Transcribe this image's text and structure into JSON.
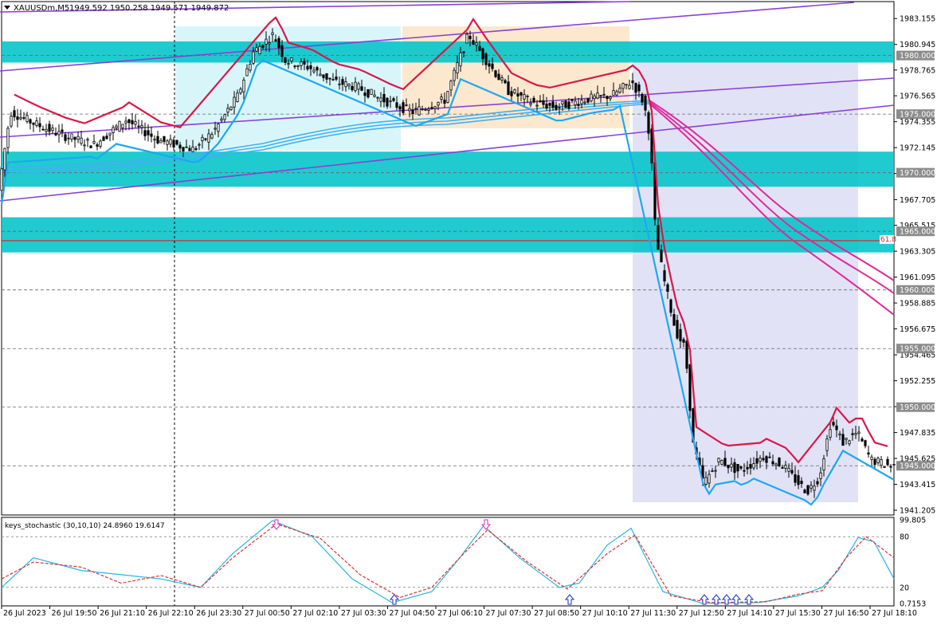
{
  "header": {
    "symbol": "XAUUSDm,M5",
    "ohlc": "1949.592 1950.258 1949.571 1949.872",
    "menu_icon": "triangle-down-icon"
  },
  "chart_data": [
    {
      "type": "candlestick",
      "symbol": "XAUUSDm",
      "timeframe": "M5",
      "ylim": [
        1940.8,
        1984.6
      ],
      "price_ticks": [
        "1983.155",
        "1980.945",
        "1978.765",
        "1976.565",
        "1974.355",
        "1972.145",
        "1969.935",
        "1967.705",
        "1965.515",
        "1963.305",
        "1961.095",
        "1958.885",
        "1956.675",
        "1954.465",
        "1952.255",
        "1950.045",
        "1947.835",
        "1945.625",
        "1943.415",
        "1941.205"
      ],
      "time_ticks": [
        "26 Jul 2023",
        "26 Jul 19:50",
        "26 Jul 21:10",
        "26 Jul 22:10",
        "26 Jul 23:30",
        "27 Jul 00:50",
        "27 Jul 02:10",
        "27 Jul 03:30",
        "27 Jul 04:50",
        "27 Jul 06:10",
        "27 Jul 07:30",
        "27 Jul 08:50",
        "27 Jul 10:10",
        "27 Jul 11:30",
        "27 Jul 12:50",
        "27 Jul 14:10",
        "27 Jul 15:30",
        "27 Jul 16:50",
        "27 Jul 18:10"
      ],
      "key_levels": [
        {
          "label": "1980.000",
          "value": 1980.0
        },
        {
          "label": "1975.000",
          "value": 1975.0
        },
        {
          "label": "1970.000",
          "value": 1970.0
        },
        {
          "label": "1965.000",
          "value": 1965.0
        },
        {
          "label": "1960.000",
          "value": 1960.0
        },
        {
          "label": "1955.000",
          "value": 1955.0
        },
        {
          "label": "1950.000",
          "value": 1950.0
        },
        {
          "label": "1945.000",
          "value": 1945.0
        }
      ],
      "fib_level": {
        "label": "61.8",
        "value": 1964.2
      },
      "zones": [
        {
          "low": 1979.4,
          "high": 1981.2,
          "color": "#00c4c8"
        },
        {
          "low": 1968.8,
          "high": 1971.8,
          "color": "#00c4c8"
        },
        {
          "low": 1963.2,
          "high": 1966.2,
          "color": "#00c4c8"
        }
      ],
      "series_points": [
        {
          "t": 0,
          "price": 1968.5
        },
        {
          "t": 15,
          "price": 1975.2
        },
        {
          "t": 45,
          "price": 1974.2
        },
        {
          "t": 80,
          "price": 1973.2
        },
        {
          "t": 120,
          "price": 1972.4
        },
        {
          "t": 160,
          "price": 1974.5
        },
        {
          "t": 200,
          "price": 1972.8
        },
        {
          "t": 245,
          "price": 1972.0
        },
        {
          "t": 270,
          "price": 1973.5
        },
        {
          "t": 300,
          "price": 1976.5
        },
        {
          "t": 320,
          "price": 1980.3
        },
        {
          "t": 345,
          "price": 1981.8
        },
        {
          "t": 360,
          "price": 1979.6
        },
        {
          "t": 390,
          "price": 1979.0
        },
        {
          "t": 420,
          "price": 1977.8
        },
        {
          "t": 450,
          "price": 1977.3
        },
        {
          "t": 490,
          "price": 1976.0
        },
        {
          "t": 520,
          "price": 1975.2
        },
        {
          "t": 560,
          "price": 1976.2
        },
        {
          "t": 590,
          "price": 1981.8
        },
        {
          "t": 610,
          "price": 1979.8
        },
        {
          "t": 640,
          "price": 1977.0
        },
        {
          "t": 670,
          "price": 1976.0
        },
        {
          "t": 700,
          "price": 1975.6
        },
        {
          "t": 740,
          "price": 1976.3
        },
        {
          "t": 770,
          "price": 1976.6
        },
        {
          "t": 795,
          "price": 1977.8
        },
        {
          "t": 810,
          "price": 1976.0
        },
        {
          "t": 818,
          "price": 1973.0
        },
        {
          "t": 825,
          "price": 1964.5
        },
        {
          "t": 835,
          "price": 1961.0
        },
        {
          "t": 850,
          "price": 1956.5
        },
        {
          "t": 862,
          "price": 1955.0
        },
        {
          "t": 872,
          "price": 1946.8
        },
        {
          "t": 885,
          "price": 1943.5
        },
        {
          "t": 905,
          "price": 1945.5
        },
        {
          "t": 930,
          "price": 1944.5
        },
        {
          "t": 960,
          "price": 1945.8
        },
        {
          "t": 985,
          "price": 1945.0
        },
        {
          "t": 1000,
          "price": 1943.8
        },
        {
          "t": 1015,
          "price": 1942.8
        },
        {
          "t": 1030,
          "price": 1944.0
        },
        {
          "t": 1045,
          "price": 1948.8
        },
        {
          "t": 1060,
          "price": 1947.0
        },
        {
          "t": 1078,
          "price": 1947.8
        },
        {
          "t": 1095,
          "price": 1945.5
        },
        {
          "t": 1120,
          "price": 1945.0
        }
      ]
    },
    {
      "type": "line",
      "indicator": "keys_stochastic (30,10,10) 24.8960 19.6147",
      "ylim": [
        0,
        100
      ],
      "y_ticks": [
        "99.805",
        "80",
        "20",
        "0.7153"
      ],
      "series": [
        {
          "color": "#28b4e0",
          "points": [
            {
              "t": 0,
              "v": 20
            },
            {
              "t": 40,
              "v": 55
            },
            {
              "t": 100,
              "v": 40
            },
            {
              "t": 150,
              "v": 35
            },
            {
              "t": 200,
              "v": 30
            },
            {
              "t": 250,
              "v": 20
            },
            {
              "t": 290,
              "v": 60
            },
            {
              "t": 340,
              "v": 99
            },
            {
              "t": 390,
              "v": 80
            },
            {
              "t": 440,
              "v": 30
            },
            {
              "t": 490,
              "v": 2
            },
            {
              "t": 540,
              "v": 15
            },
            {
              "t": 575,
              "v": 55
            },
            {
              "t": 605,
              "v": 93
            },
            {
              "t": 650,
              "v": 55
            },
            {
              "t": 700,
              "v": 20
            },
            {
              "t": 725,
              "v": 25
            },
            {
              "t": 760,
              "v": 70
            },
            {
              "t": 790,
              "v": 90
            },
            {
              "t": 830,
              "v": 15
            },
            {
              "t": 880,
              "v": 1
            },
            {
              "t": 950,
              "v": 2
            },
            {
              "t": 1000,
              "v": 10
            },
            {
              "t": 1030,
              "v": 20
            },
            {
              "t": 1050,
              "v": 40
            },
            {
              "t": 1075,
              "v": 79
            },
            {
              "t": 1095,
              "v": 74
            },
            {
              "t": 1120,
              "v": 30
            }
          ]
        },
        {
          "color": "#e03030",
          "dashed": true,
          "points": [
            {
              "t": 0,
              "v": 30
            },
            {
              "t": 40,
              "v": 50
            },
            {
              "t": 100,
              "v": 44
            },
            {
              "t": 150,
              "v": 25
            },
            {
              "t": 200,
              "v": 34
            },
            {
              "t": 250,
              "v": 20
            },
            {
              "t": 290,
              "v": 55
            },
            {
              "t": 345,
              "v": 95
            },
            {
              "t": 400,
              "v": 78
            },
            {
              "t": 450,
              "v": 35
            },
            {
              "t": 500,
              "v": 8
            },
            {
              "t": 540,
              "v": 20
            },
            {
              "t": 580,
              "v": 60
            },
            {
              "t": 610,
              "v": 88
            },
            {
              "t": 660,
              "v": 50
            },
            {
              "t": 710,
              "v": 18
            },
            {
              "t": 760,
              "v": 60
            },
            {
              "t": 795,
              "v": 82
            },
            {
              "t": 840,
              "v": 10
            },
            {
              "t": 890,
              "v": 2
            },
            {
              "t": 960,
              "v": 3
            },
            {
              "t": 1000,
              "v": 12
            },
            {
              "t": 1030,
              "v": 16
            },
            {
              "t": 1060,
              "v": 55
            },
            {
              "t": 1085,
              "v": 80
            },
            {
              "t": 1120,
              "v": 55
            }
          ]
        }
      ],
      "signals": [
        {
          "t": 345,
          "dir": "down"
        },
        {
          "t": 608,
          "dir": "down"
        },
        {
          "t": 493,
          "dir": "up"
        },
        {
          "t": 713,
          "dir": "up"
        },
        {
          "t": 882,
          "dir": "up"
        },
        {
          "t": 897,
          "dir": "up"
        },
        {
          "t": 910,
          "dir": "up"
        },
        {
          "t": 922,
          "dir": "up"
        },
        {
          "t": 938,
          "dir": "up"
        }
      ]
    }
  ]
}
